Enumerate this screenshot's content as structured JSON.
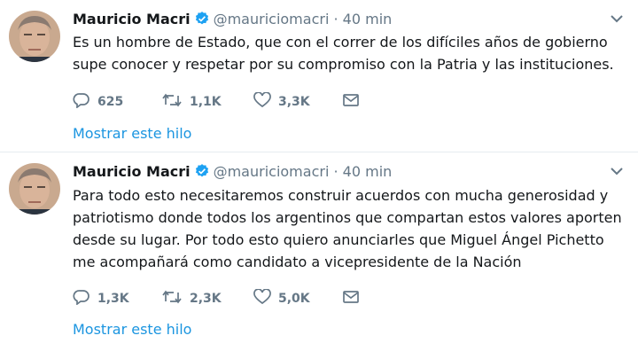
{
  "tweets": [
    {
      "name": "Mauricio Macri",
      "handle": "@mauriciomacri",
      "separator": "·",
      "time": "40 min",
      "text": "Es un hombre de Estado, que con el correr de los difíciles años de gobierno supe conocer y respetar por su compromiso con la Patria y las instituciones.",
      "replies": "625",
      "retweets": "1,1K",
      "likes": "3,3K",
      "thread_link": "Mostrar este hilo"
    },
    {
      "name": "Mauricio Macri",
      "handle": "@mauriciomacri",
      "separator": "·",
      "time": "40 min",
      "text": "Para todo esto necesitaremos construir acuerdos con mucha generosidad y patriotismo donde todos los argentinos que compartan estos valores aporten desde su lugar. Por todo esto quiero anunciarles que Miguel Ángel Pichetto me acompañará como candidato a vicepresidente de la Nación",
      "replies": "1,3K",
      "retweets": "2,3K",
      "likes": "5,0K",
      "thread_link": "Mostrar este hilo"
    }
  ],
  "icons": {
    "reply": "reply-icon",
    "retweet": "retweet-icon",
    "like": "heart-icon",
    "dm": "envelope-icon",
    "verified": "verified-badge-icon",
    "caret": "chevron-down-icon"
  },
  "colors": {
    "accent": "#1b95e0",
    "verified": "#1da1f2",
    "muted": "#657786",
    "text": "#14171a"
  }
}
